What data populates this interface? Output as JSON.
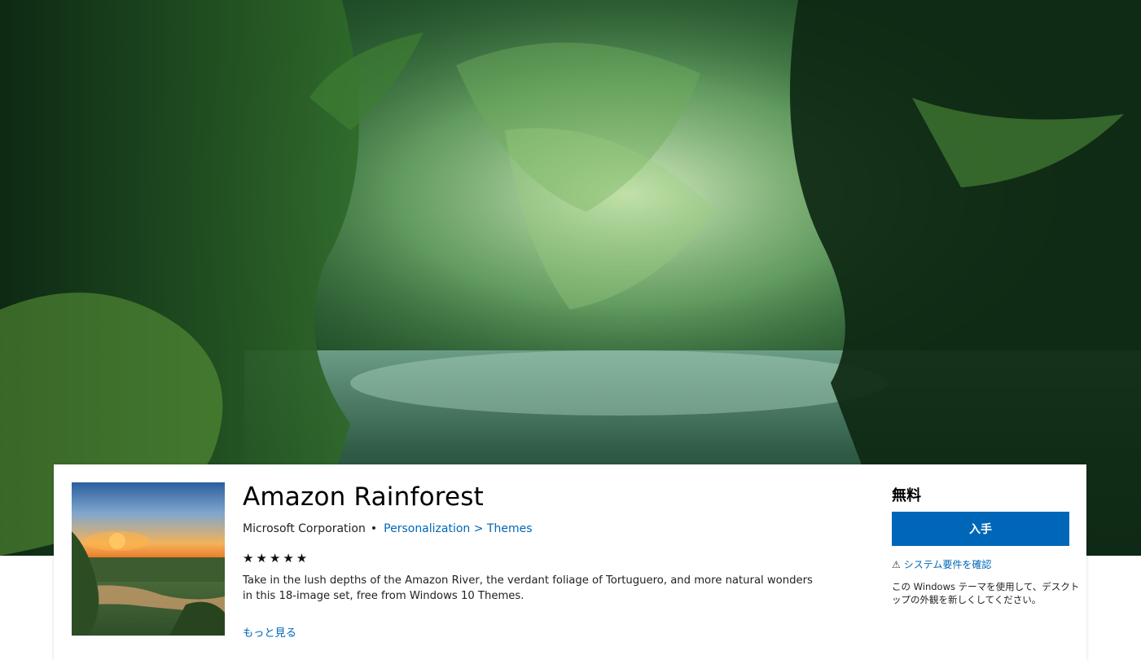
{
  "hero": {
    "image_icon": "rainforest-river-landscape"
  },
  "product": {
    "title": "Amazon Rainforest",
    "publisher": "Microsoft Corporation",
    "separator": "•",
    "category": "Personalization > Themes",
    "stars": "★★★★★",
    "rating": 5,
    "description": "Take in the lush depths of the Amazon River, the verdant foliage of Tortuguero, and more natural wonders in this 18-image set, free from Windows 10 Themes.",
    "more_label": "もっと見る",
    "thumbnail_icon": "sunset-river-thumbnail"
  },
  "purchase": {
    "price": "無料",
    "get_label": "入手",
    "sysreq_icon": "⚠",
    "sysreq_label": "システム要件を確認",
    "note": "この Windows テーマを使用して、デスクトップの外観を新しくしてください。"
  },
  "colors": {
    "accent": "#0067b8",
    "link": "#0067b8"
  }
}
